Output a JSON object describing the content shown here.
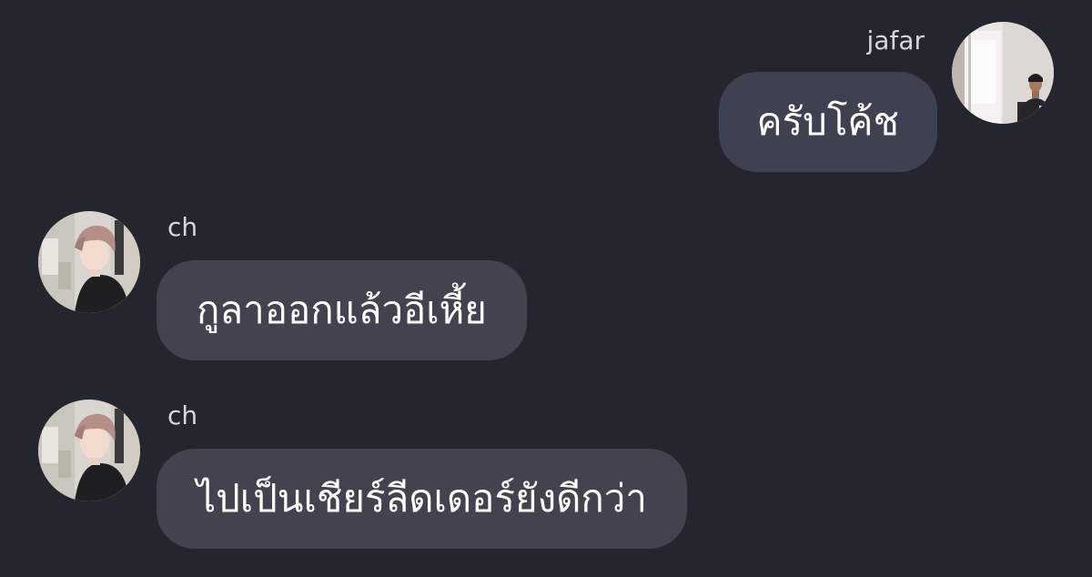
{
  "chat": {
    "messages": [
      {
        "sender": "jafar",
        "text": "ครับโค้ช",
        "outgoing": true
      },
      {
        "sender": "ch",
        "text": "กูลาออกแล้วอีเหี้ย",
        "outgoing": false
      },
      {
        "sender": "ch",
        "text": "ไปเป็นเชียร์ลีดเดอร์ยังดีกว่า",
        "outgoing": false
      }
    ]
  }
}
